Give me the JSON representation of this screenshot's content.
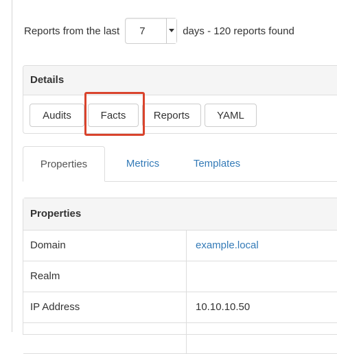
{
  "filter": {
    "prefix": "Reports from the last",
    "days_value": "7",
    "suffix": "days - 120 reports found"
  },
  "details": {
    "heading": "Details",
    "buttons": [
      "Audits",
      "Facts",
      "Reports",
      "YAML"
    ],
    "highlighted": "Facts"
  },
  "tabs": [
    {
      "label": "Properties",
      "active": true
    },
    {
      "label": "Metrics",
      "active": false
    },
    {
      "label": "Templates",
      "active": false
    }
  ],
  "properties": {
    "heading": "Properties",
    "rows": [
      {
        "key": "Domain",
        "value": "example.local",
        "is_link": true
      },
      {
        "key": "Realm",
        "value": "",
        "is_link": false
      },
      {
        "key": "IP Address",
        "value": "10.10.10.50",
        "is_link": false
      }
    ]
  },
  "colors": {
    "link": "#337ab7",
    "highlight_border": "#d9432c",
    "panel_heading_bg": "#f5f5f5",
    "border": "#dddddd"
  }
}
